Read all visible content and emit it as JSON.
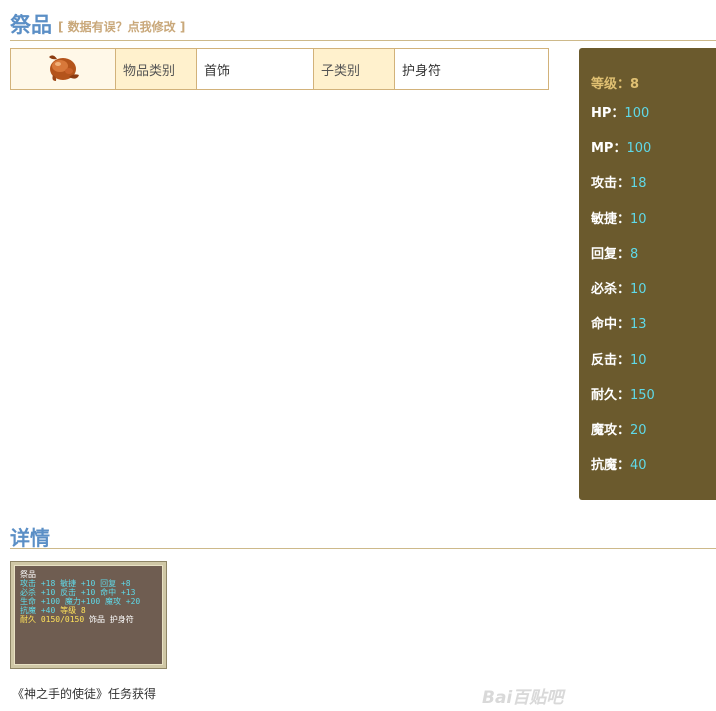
{
  "page": {
    "title": "祭品",
    "edit_link": "[ 数据有误？点我修改 ]"
  },
  "info": {
    "category_label": "物品类别",
    "category_value": "首饰",
    "subcategory_label": "子类别",
    "subcategory_value": "护身符"
  },
  "stats": {
    "level": {
      "label": "等级：",
      "value": "8"
    },
    "hp": {
      "label": "HP：",
      "value": "100"
    },
    "mp": {
      "label": "MP：",
      "value": "100"
    },
    "attack": {
      "label": "攻击：",
      "value": "18"
    },
    "agility": {
      "label": "敏捷：",
      "value": "10"
    },
    "recovery": {
      "label": "回复：",
      "value": "8"
    },
    "critical": {
      "label": "必杀：",
      "value": "10"
    },
    "hit": {
      "label": "命中：",
      "value": "13"
    },
    "counter": {
      "label": "反击：",
      "value": "10"
    },
    "durability": {
      "label": "耐久：",
      "value": "150"
    },
    "magic_attack": {
      "label": "魔攻：",
      "value": "20"
    },
    "magic_resist": {
      "label": "抗魔：",
      "value": "40"
    }
  },
  "details": {
    "title": "详情",
    "tooltip": {
      "title": "祭品",
      "line1": "攻击 +18 敏捷 +10 回复  +8",
      "line2": "必杀 +10 反击 +10 命中 +13",
      "line3": "生命 +100 魔力+100 魔攻 +20",
      "line4a": "抗魔 +40",
      "line4b": " 等级 8",
      "line5a": "耐久 0150/0150",
      "line5b": " 饰品 护身符"
    },
    "source": "《神之手的使徒》任务获得"
  },
  "watermark": "Bai百贴吧",
  "colors": {
    "title_blue": "#5b8fc6",
    "panel_brown": "#6b5a2d",
    "stat_value_cyan": "#5fd9e8",
    "label_bg": "#fff1cd"
  }
}
